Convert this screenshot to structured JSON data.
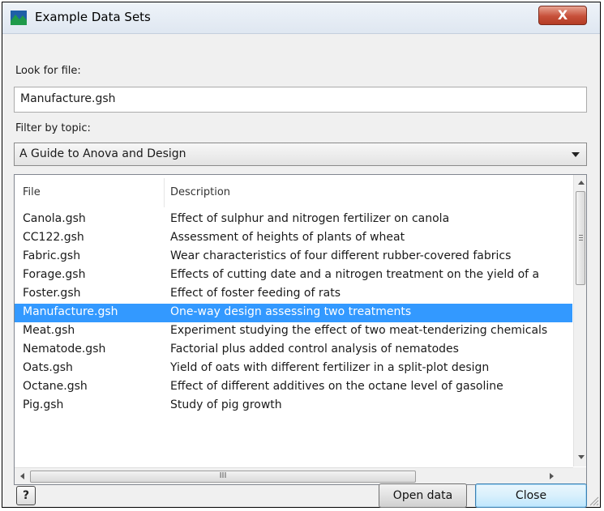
{
  "window": {
    "title": "Example Data Sets",
    "close_glyph": "X"
  },
  "look_for": {
    "label": "Look for file:",
    "value": "Manufacture.gsh"
  },
  "filter": {
    "label": "Filter by topic:",
    "selected": "A Guide to Anova and Design"
  },
  "list": {
    "headers": {
      "file": "File",
      "description": "Description"
    },
    "selected_index": 5,
    "rows": [
      {
        "file": "Canola.gsh",
        "description": "Effect of sulphur and nitrogen fertilizer on canola"
      },
      {
        "file": "CC122.gsh",
        "description": "Assessment of heights of plants of wheat"
      },
      {
        "file": "Fabric.gsh",
        "description": "Wear characteristics of four different rubber-covered fabrics"
      },
      {
        "file": "Forage.gsh",
        "description": "Effects of cutting date and a nitrogen treatment on the yield of a"
      },
      {
        "file": "Foster.gsh",
        "description": "Effect of foster feeding of rats"
      },
      {
        "file": "Manufacture.gsh",
        "description": "One-way design assessing two treatments"
      },
      {
        "file": "Meat.gsh",
        "description": "Experiment studying the effect of two meat-tenderizing chemicals"
      },
      {
        "file": "Nematode.gsh",
        "description": "Factorial plus added control analysis of nematodes"
      },
      {
        "file": "Oats.gsh",
        "description": "Yield of oats with different fertilizer in a split-plot design"
      },
      {
        "file": "Octane.gsh",
        "description": "Effect of different additives on the octane level of gasoline"
      },
      {
        "file": "Pig.gsh",
        "description": "Study of pig growth"
      }
    ],
    "hscroll_grip": "III"
  },
  "buttons": {
    "help": "?",
    "open": "Open data",
    "close": "Close"
  },
  "colors": {
    "selection": "#3399ff",
    "window_bg": "#f0f0f0",
    "icon_green": "#1f9a4a",
    "icon_blue": "#1e5fa8"
  },
  "icons": {
    "app": "chart-area-icon",
    "help": "question-mark-icon"
  }
}
